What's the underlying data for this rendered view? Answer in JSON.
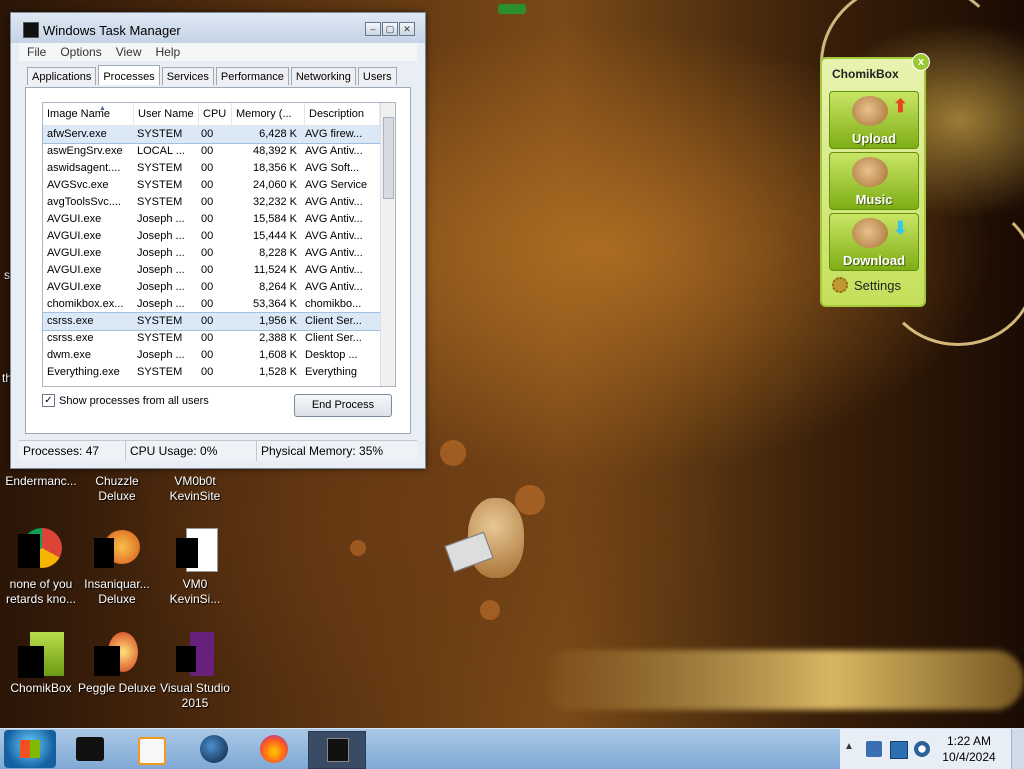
{
  "task_manager": {
    "title": "Windows Task Manager",
    "window_buttons": [
      "–",
      "▢",
      "✕"
    ],
    "menu": [
      "File",
      "Options",
      "View",
      "Help"
    ],
    "tabs": [
      "Applications",
      "Processes",
      "Services",
      "Performance",
      "Networking",
      "Users"
    ],
    "active_tab": "Processes",
    "columns": [
      "Image Name",
      "User Name",
      "CPU",
      "Memory (...",
      "Description"
    ],
    "rows": [
      {
        "name": "afwServ.exe",
        "user": "SYSTEM",
        "cpu": "00",
        "mem": "6,428 K",
        "desc": "AVG firew..."
      },
      {
        "name": "aswEngSrv.exe",
        "user": "LOCAL ...",
        "cpu": "00",
        "mem": "48,392 K",
        "desc": "AVG Antiv..."
      },
      {
        "name": "aswidsagent....",
        "user": "SYSTEM",
        "cpu": "00",
        "mem": "18,356 K",
        "desc": "AVG Soft..."
      },
      {
        "name": "AVGSvc.exe",
        "user": "SYSTEM",
        "cpu": "00",
        "mem": "24,060 K",
        "desc": "AVG Service"
      },
      {
        "name": "avgToolsSvc....",
        "user": "SYSTEM",
        "cpu": "00",
        "mem": "32,232 K",
        "desc": "AVG Antiv..."
      },
      {
        "name": "AVGUI.exe",
        "user": "Joseph ...",
        "cpu": "00",
        "mem": "15,584 K",
        "desc": "AVG Antiv..."
      },
      {
        "name": "AVGUI.exe",
        "user": "Joseph ...",
        "cpu": "00",
        "mem": "15,444 K",
        "desc": "AVG Antiv..."
      },
      {
        "name": "AVGUI.exe",
        "user": "Joseph ...",
        "cpu": "00",
        "mem": "8,228 K",
        "desc": "AVG Antiv..."
      },
      {
        "name": "AVGUI.exe",
        "user": "Joseph ...",
        "cpu": "00",
        "mem": "11,524 K",
        "desc": "AVG Antiv..."
      },
      {
        "name": "AVGUI.exe",
        "user": "Joseph ...",
        "cpu": "00",
        "mem": "8,264 K",
        "desc": "AVG Antiv..."
      },
      {
        "name": "chomikbox.ex...",
        "user": "Joseph ...",
        "cpu": "00",
        "mem": "53,364 K",
        "desc": "chomikbo..."
      },
      {
        "name": "csrss.exe",
        "user": "SYSTEM",
        "cpu": "00",
        "mem": "1,956 K",
        "desc": "Client Ser..."
      },
      {
        "name": "csrss.exe",
        "user": "SYSTEM",
        "cpu": "00",
        "mem": "2,388 K",
        "desc": "Client Ser..."
      },
      {
        "name": "dwm.exe",
        "user": "Joseph ...",
        "cpu": "00",
        "mem": "1,608 K",
        "desc": "Desktop ..."
      },
      {
        "name": "Everything.exe",
        "user": "SYSTEM",
        "cpu": "00",
        "mem": "1,528 K",
        "desc": "Everything"
      }
    ],
    "show_all_label": "Show processes from all users",
    "show_all_checked": "✓",
    "end_process_label": "End Process",
    "status": {
      "processes": "Processes: 47",
      "cpu": "CPU Usage: 0%",
      "memory": "Physical Memory: 35%"
    }
  },
  "chomikbox": {
    "title": "ChomikBox",
    "close": "x",
    "upload": "Upload",
    "music": "Music",
    "download": "Download",
    "settings": "Settings"
  },
  "desktop": {
    "icons": [
      {
        "label1": "Endermanc...",
        "label2": ""
      },
      {
        "label1": "Chuzzle",
        "label2": "Deluxe"
      },
      {
        "label1": "VM0b0t",
        "label2": "KevinSite"
      },
      {
        "label1": "none of you",
        "label2": "retards kno..."
      },
      {
        "label1": "Insaniquar...",
        "label2": "Deluxe"
      },
      {
        "label1": "VM0",
        "label2": "KevinSi..."
      },
      {
        "label1": "ChomikBox",
        "label2": ""
      },
      {
        "label1": "Peggle Deluxe",
        "label2": ""
      },
      {
        "label1": "Visual Studio",
        "label2": "2015"
      }
    ],
    "edge_fragments": [
      "s",
      "th"
    ]
  },
  "taskbar": {
    "time": "1:22 AM",
    "date": "10/4/2024"
  },
  "colors": {
    "taskbar": "#8fb6dd",
    "chomik_green": "#9bc735",
    "selection": "#dbe9f7"
  }
}
